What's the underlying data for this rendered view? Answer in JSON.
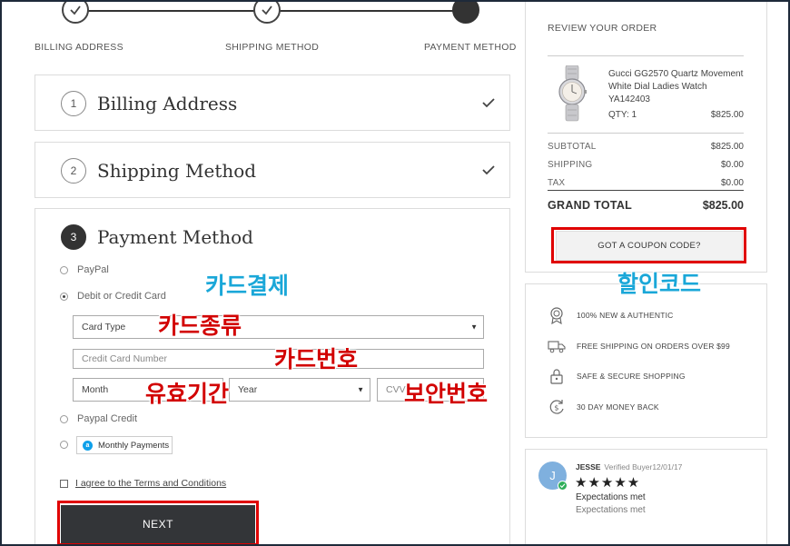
{
  "stepper": {
    "steps": [
      {
        "label": "BILLING ADDRESS",
        "state": "done"
      },
      {
        "label": "SHIPPING METHOD",
        "state": "done"
      },
      {
        "label": "PAYMENT METHOD",
        "state": "active"
      }
    ]
  },
  "billing": {
    "number": "1",
    "title": "Billing Address"
  },
  "shipping": {
    "number": "2",
    "title": "Shipping Method"
  },
  "payment": {
    "number": "3",
    "title": "Payment Method",
    "options": {
      "paypal": "PayPal",
      "card": "Debit or Credit Card",
      "paypal_credit": "Paypal Credit",
      "monthly": "Monthly Payments"
    },
    "selected": "card",
    "card_type": "Card Type",
    "card_number_placeholder": "Credit Card Number",
    "month": "Month",
    "year": "Year",
    "cvv_placeholder": "CVV"
  },
  "terms": {
    "label": "I agree to the Terms and Conditions"
  },
  "next_label": "NEXT",
  "annotations": {
    "card_payment": "카드결제",
    "card_type": "카드종류",
    "card_number": "카드번호",
    "expiry": "유효기간",
    "security_code": "보안번호",
    "discount_code": "할인코드"
  },
  "order": {
    "title": "REVIEW YOUR ORDER",
    "product_name": "Gucci GG2570 Quartz Movement White Dial Ladies Watch YA142403",
    "qty": "QTY:  1",
    "price": "$825.00",
    "subtotal_label": "SUBTOTAL",
    "subtotal": "$825.00",
    "shipping_label": "SHIPPING",
    "shipping": "$0.00",
    "tax_label": "TAX",
    "tax": "$0.00",
    "grand_total_label": "GRAND TOTAL",
    "grand_total": "$825.00",
    "coupon_label": "GOT A COUPON CODE?"
  },
  "features": [
    {
      "icon": "badge-icon",
      "text": "100% NEW & AUTHENTIC"
    },
    {
      "icon": "truck-icon",
      "text": "FREE SHIPPING ON ORDERS OVER $99"
    },
    {
      "icon": "lock-icon",
      "text": "SAFE & SECURE SHOPPING"
    },
    {
      "icon": "money-back-icon",
      "text": "30 DAY MONEY BACK"
    }
  ],
  "review": {
    "avatar_letter": "J",
    "name": "JESSE",
    "meta": "Verified Buyer12/01/17",
    "stars": "★★★★★",
    "rating": 5,
    "line1": "Expectations met",
    "line2": "Expectations met"
  },
  "colors": {
    "accent_dark": "#333538",
    "highlight_red": "#e00000",
    "annotation_blue": "#1aa7d8",
    "annotation_red": "#d20000"
  }
}
